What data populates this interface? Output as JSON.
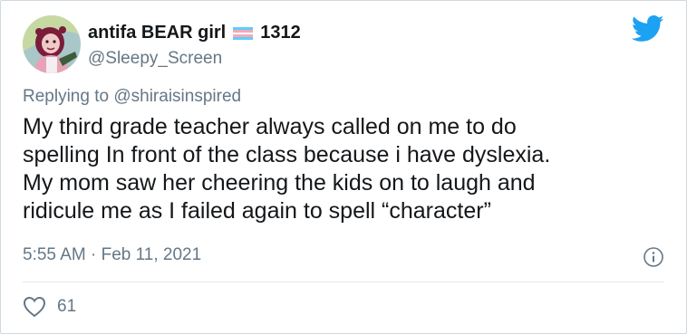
{
  "user": {
    "display_name": "antifa BEAR girl",
    "name_suffix": "1312",
    "handle": "@Sleepy_Screen",
    "avatar_icon": "avatar-illustration"
  },
  "reply": {
    "prefix": "Replying to ",
    "handle": "@shiraisinspired"
  },
  "tweet": {
    "lines": [
      "My third grade teacher always called on me to do",
      "spelling In front of the class because i have dyslexia.",
      "My mom saw her cheering the kids on to laugh and",
      "ridicule me as I failed again to spell “character”"
    ]
  },
  "meta": {
    "time": "5:55 AM",
    "separator": "·",
    "date": "Feb 11, 2021"
  },
  "engagement": {
    "likes": "61"
  },
  "colors": {
    "twitter_blue": "#1da1f2",
    "secondary_text": "#657786",
    "primary_text": "#14171a",
    "flag_blue": "#5bcefa",
    "flag_pink": "#f5a9b8"
  }
}
